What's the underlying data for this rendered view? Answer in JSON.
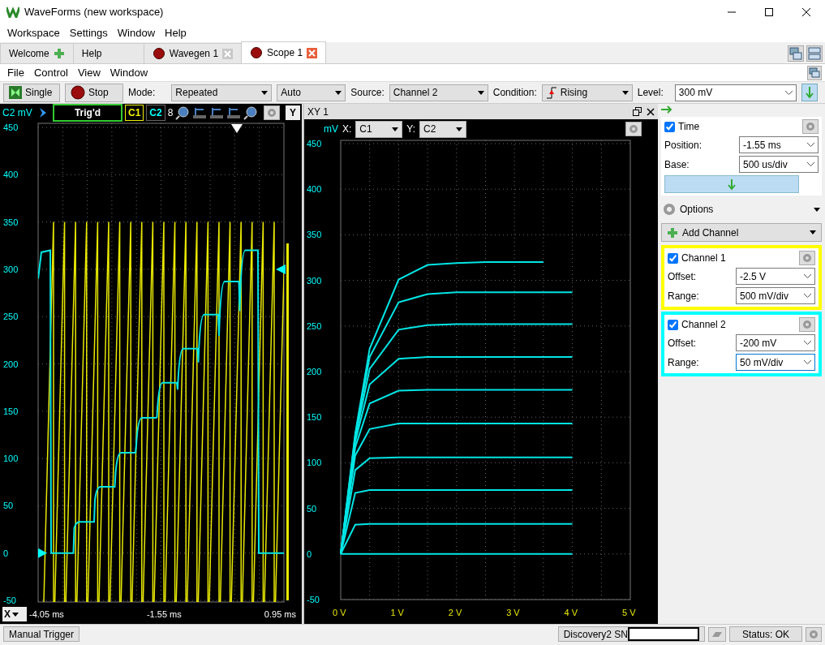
{
  "window": {
    "title": "WaveForms (new workspace)"
  },
  "menu": [
    "Workspace",
    "Settings",
    "Window",
    "Help"
  ],
  "tabs": [
    {
      "label": "Welcome",
      "kind": "add",
      "selected": false
    },
    {
      "label": "Help",
      "kind": "plain",
      "selected": false
    },
    {
      "label": "Wavegen 1",
      "kind": "instrument",
      "selected": false
    },
    {
      "label": "Scope 1",
      "kind": "instrument",
      "selected": true
    }
  ],
  "instrument_menu": [
    "File",
    "Control",
    "View",
    "Window"
  ],
  "toolbar": {
    "single": "Single",
    "stop": "Stop",
    "mode_label": "Mode:",
    "mode": "Repeated",
    "mode2": "Auto",
    "source_label": "Source:",
    "source": "Channel 2",
    "condition_label": "Condition:",
    "condition": "Rising",
    "level_label": "Level:",
    "level": "300 mV"
  },
  "scope": {
    "unit": "C2 mV",
    "trigger_status": "Trig'd",
    "channels": [
      {
        "label": "C1",
        "color": "#f0f000",
        "selected": true
      },
      {
        "label": "C2",
        "color": "#00ffff",
        "selected": false
      }
    ],
    "zoom_count": "8",
    "y_button": "Y",
    "x_button": "X",
    "yticks": [
      "450",
      "400",
      "350",
      "300",
      "250",
      "200",
      "150",
      "100",
      "50",
      "0",
      "-50"
    ],
    "xlabels": [
      "-4.05 ms",
      "-1.55 ms",
      "0.95 ms"
    ]
  },
  "xy": {
    "title": "XY 1",
    "unit": "mV",
    "x_label": "X:",
    "x_source": "C1",
    "y_label": "Y:",
    "y_source": "C2",
    "chart_data": {
      "type": "line",
      "grid": true,
      "x": [
        0,
        0.25,
        0.5,
        1,
        1.5,
        2,
        2.5,
        3,
        3.5,
        4
      ],
      "xlim": [
        0,
        5
      ],
      "ylim": [
        -50,
        450
      ],
      "xticks": [
        {
          "value": 0,
          "label": "0 V"
        },
        {
          "value": 1,
          "label": "1 V"
        },
        {
          "value": 2,
          "label": "2 V"
        },
        {
          "value": 3,
          "label": "3 V"
        },
        {
          "value": 4,
          "label": "4 V"
        },
        {
          "value": 5,
          "label": "5 V"
        }
      ],
      "yticks": [
        450,
        400,
        350,
        300,
        250,
        200,
        150,
        100,
        50,
        0,
        -50
      ],
      "series": [
        {
          "color": "#00e5e5",
          "values": [
            0,
            132,
            225,
            301,
            317,
            319,
            320,
            320,
            320,
            null
          ]
        },
        {
          "color": "#00e5e5",
          "values": [
            0,
            130,
            216,
            276,
            285,
            287,
            287,
            287,
            287,
            287
          ]
        },
        {
          "color": "#00e5e5",
          "values": [
            0,
            127,
            203,
            246,
            251,
            252,
            252,
            252,
            252,
            252
          ]
        },
        {
          "color": "#00e5e5",
          "values": [
            0,
            123,
            186,
            214,
            216,
            216,
            216,
            216,
            216,
            216
          ]
        },
        {
          "color": "#00e5e5",
          "values": [
            0,
            117,
            165,
            179,
            180,
            180,
            180,
            180,
            180,
            180
          ]
        },
        {
          "color": "#00e5e5",
          "values": [
            0,
            108,
            137,
            143,
            143,
            143,
            143,
            143,
            143,
            143
          ]
        },
        {
          "color": "#00e5e5",
          "values": [
            0,
            92,
            105,
            106,
            106,
            106,
            106,
            106,
            106,
            106
          ]
        },
        {
          "color": "#00e5e5",
          "values": [
            0,
            67,
            70,
            70,
            70,
            70,
            70,
            70,
            70,
            70
          ]
        },
        {
          "color": "#00e5e5",
          "values": [
            0,
            32,
            33,
            33,
            33,
            33,
            33,
            33,
            33,
            33
          ]
        },
        {
          "color": "#00e5e5",
          "values": [
            0,
            0,
            0,
            0,
            0,
            0,
            0,
            0,
            0,
            0
          ]
        }
      ]
    }
  },
  "panel": {
    "time": {
      "title": "Time",
      "checked": true,
      "position_label": "Position:",
      "position": "-1.55 ms",
      "base_label": "Base:",
      "base": "500 us/div"
    },
    "options": "Options",
    "add_channel": "Add Channel",
    "channels": [
      {
        "title": "Channel 1",
        "checked": true,
        "color": "#ffff00",
        "offset_label": "Offset:",
        "offset": "-2.5 V",
        "range_label": "Range:",
        "range": "500 mV/div"
      },
      {
        "title": "Channel 2",
        "checked": true,
        "color": "#00ffff",
        "offset_label": "Offset:",
        "offset": "-200 mV",
        "range_label": "Range:",
        "range": "50 mV/div"
      }
    ]
  },
  "status_bar": {
    "manual_trigger": "Manual Trigger",
    "device": "Discovery2 SN",
    "status": "Status: OK"
  }
}
